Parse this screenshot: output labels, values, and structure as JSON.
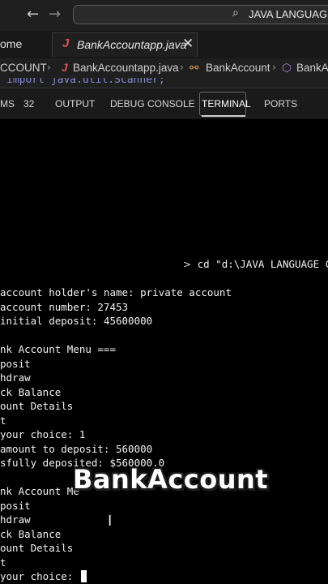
{
  "titlebar": {
    "back_icon": "arrow-left-icon",
    "forward_icon": "arrow-right-icon",
    "search_icon": "search-icon",
    "search_text": "JAVA LANGUAGE C"
  },
  "tabs": {
    "home_label": "ome",
    "active_icon": "java-file-icon",
    "active_icon_glyph": "J",
    "active_label": "BankAccountapp.java",
    "close_glyph": "✕"
  },
  "breadcrumb": {
    "items": [
      "CCOUNT",
      "BankAccountapp.java",
      "BankAccount",
      "BankAcc"
    ],
    "java_glyph": "J",
    "class_glyph": "⚯",
    "method_glyph": "⬡"
  },
  "code_peek": "import java.util.Scanner;",
  "panel": {
    "tabs": [
      {
        "label": "MS",
        "active": false
      },
      {
        "label": "32",
        "active": false
      },
      {
        "label": "OUTPUT",
        "active": false
      },
      {
        "label": "DEBUG CONSOLE",
        "active": false
      },
      {
        "label": "TERMINAL",
        "active": true
      },
      {
        "label": "PORTS",
        "active": false
      }
    ]
  },
  "terminal": {
    "prompt_glyph": ">",
    "command": "cd \"d:\\JAVA LANGUAGE CO",
    "lines": [
      "account holder's name: private account",
      "account number: 27453",
      "initial deposit: 45600000",
      "",
      "nk Account Menu ===",
      "posit",
      "hdraw",
      "ck Balance",
      "ount Details",
      "t",
      "your choice: 1",
      "amount to deposit: 560000",
      "sfully deposited: $560000.0",
      "",
      "nk Account Me",
      "posit",
      "hdraw",
      "ck Balance",
      "ount Details",
      "t",
      "your choice: "
    ]
  },
  "overlay": {
    "title": "BankAccount"
  }
}
